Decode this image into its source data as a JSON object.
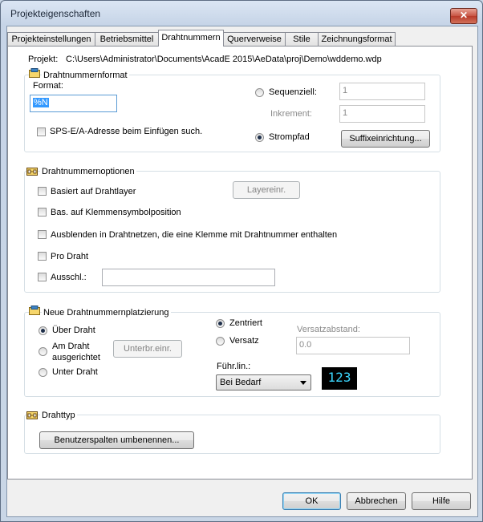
{
  "window": {
    "title": "Projekteigenschaften",
    "close_label": "✕"
  },
  "tabs": [
    {
      "label": "Projekteinstellungen"
    },
    {
      "label": "Betriebsmittel"
    },
    {
      "label": "Drahtnummern"
    },
    {
      "label": "Querverweise"
    },
    {
      "label": "Stile"
    },
    {
      "label": "Zeichnungsformat"
    }
  ],
  "project": {
    "label": "Projekt:",
    "path": "C:\\Users\\Administrator\\Documents\\AcadE 2015\\AeData\\proj\\Demo\\wddemo.wdp"
  },
  "format_group": {
    "title": "Drahtnummernformat",
    "format_label": "Format:",
    "format_value": "%N",
    "sps_label": "SPS-E/A-Adresse beim Einfügen such.",
    "sequential_label": "Sequenziell:",
    "sequential_value": "1",
    "increment_label": "Inkrement:",
    "increment_value": "1",
    "strompfad_label": "Strompfad",
    "suffix_button": "Suffixeinrichtung..."
  },
  "options_group": {
    "title": "Drahtnummernoptionen",
    "layer_label": "Basiert auf Drahtlayer",
    "layer_button": "Layereinr.",
    "klemmen_label": "Bas. auf Klemmensymbolposition",
    "hide_label": "Ausblenden in Drahtnetzen, die eine Klemme mit Drahtnummer enthalten",
    "pro_draht_label": "Pro Draht",
    "exclude_label": "Ausschl.:",
    "exclude_value": ""
  },
  "placement_group": {
    "title": "Neue Drahtnummernplatzierung",
    "above_label": "Über Draht",
    "inline_label_1": "Am Draht",
    "inline_label_2": "ausgerichtet",
    "unterbr_button": "Unterbr.einr.",
    "below_label": "Unter Draht",
    "centered_label": "Zentriert",
    "offset_label": "Versatz",
    "offset_distance_label": "Versatzabstand:",
    "offset_distance_value": "0.0",
    "leader_label": "Führ.lin.:",
    "leader_value": "Bei Bedarf",
    "preview_text": "123"
  },
  "wire_type_group": {
    "title": "Drahttyp",
    "rename_button": "Benutzerspalten umbenennen..."
  },
  "footer": {
    "ok": "OK",
    "cancel": "Abbrechen",
    "help": "Hilfe"
  },
  "colors": {
    "preview_bg": "#000000",
    "preview_text": "#3cd7ff",
    "close_button": "#c75443"
  }
}
